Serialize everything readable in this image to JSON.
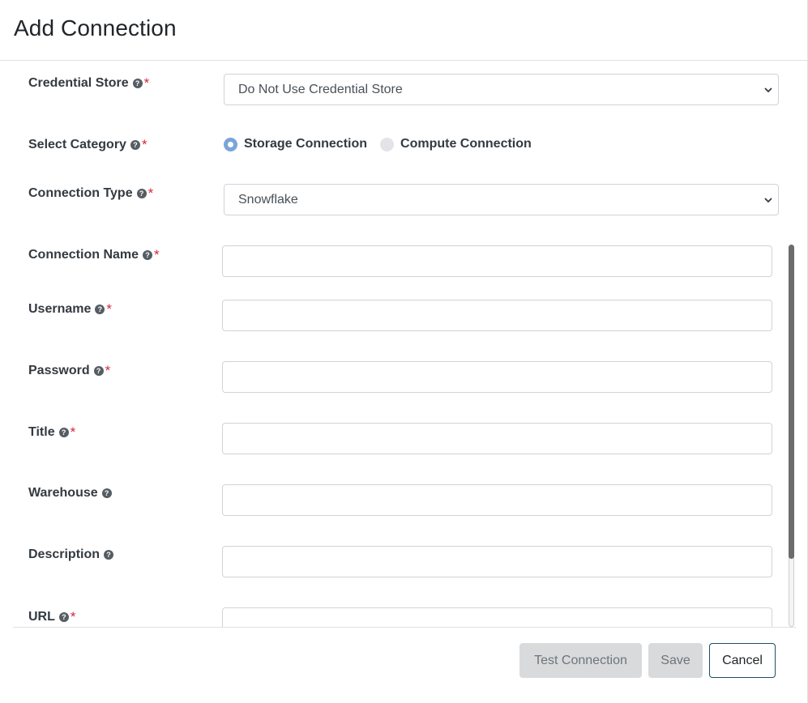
{
  "modal": {
    "title": "Add Connection"
  },
  "help_glyph": "?",
  "required_mark": "*",
  "fields": {
    "credential_store": {
      "label": "Credential Store",
      "value": "Do Not Use Credential Store",
      "required": true
    },
    "category": {
      "label": "Select Category",
      "required": true,
      "options": [
        {
          "label": "Storage Connection",
          "selected": true
        },
        {
          "label": "Compute Connection",
          "selected": false
        }
      ]
    },
    "connection_type": {
      "label": "Connection Type",
      "value": "Snowflake",
      "required": true
    },
    "connection_name": {
      "label": "Connection Name",
      "value": "",
      "required": true
    },
    "username": {
      "label": "Username",
      "value": "",
      "required": true
    },
    "password": {
      "label": "Password",
      "value": "",
      "required": true
    },
    "title": {
      "label": "Title",
      "value": "",
      "required": true
    },
    "warehouse": {
      "label": "Warehouse",
      "value": "",
      "required": false
    },
    "description": {
      "label": "Description",
      "value": "",
      "required": false
    },
    "url": {
      "label": "URL",
      "value": "",
      "required": true
    }
  },
  "footer": {
    "test_label": "Test Connection",
    "save_label": "Save",
    "cancel_label": "Cancel"
  },
  "colors": {
    "required": "#d6263c",
    "radio_selected": "#7aa5d8",
    "cancel_border": "#1f4e66",
    "disabled_button": "#d9dadb"
  },
  "icons": [
    "question-circle-icon",
    "chevron-down-icon"
  ]
}
